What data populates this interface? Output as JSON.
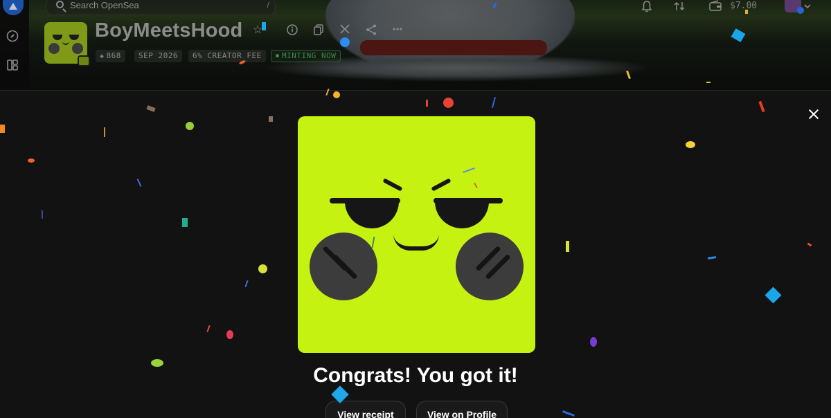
{
  "search": {
    "placeholder": "Search OpenSea",
    "shortcut": "/"
  },
  "header": {
    "balance": "$7.00"
  },
  "collection": {
    "name": "BoyMeetsHood",
    "stats": [
      {
        "icon": "layers-icon",
        "label": "868"
      },
      {
        "label": "SEP 2026"
      },
      {
        "label": "6% CREATOR FEE"
      },
      {
        "label": "MINTING NOW",
        "status": "minting"
      }
    ]
  },
  "modal": {
    "title": "Congrats! You got it!",
    "buttons": {
      "receipt": "View receipt",
      "profile": "View on Profile"
    }
  },
  "colors": {
    "nft_background": "#c6f212",
    "modal_background": "#121212",
    "minting_green": "#3f8a4b"
  },
  "icons": {
    "rail": [
      "opensea-logo-icon",
      "compass-icon",
      "dashboard-icon"
    ],
    "header_right": [
      "bell-icon",
      "swap-icon",
      "wallet-icon",
      "chevron-down-icon"
    ],
    "collection_actions": [
      "star-icon",
      "info-icon",
      "copy-icon",
      "x-logo-icon",
      "share-icon",
      "more-icon"
    ]
  }
}
